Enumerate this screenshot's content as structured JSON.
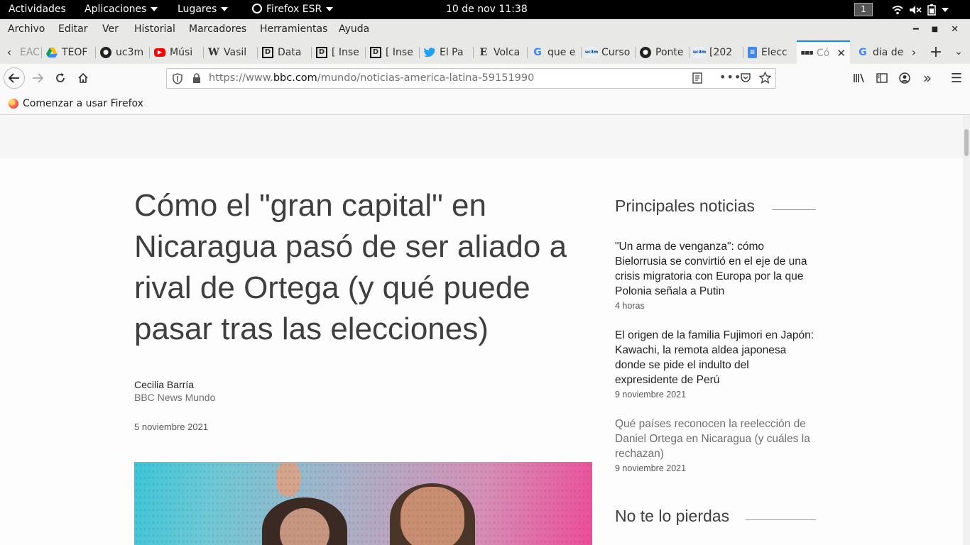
{
  "topbar": {
    "activities": "Actividades",
    "applications": "Aplicaciones",
    "places": "Lugares",
    "app_name": "Firefox ESR",
    "clock": "10 de nov  11:38",
    "workspace": "1"
  },
  "menubar": {
    "items": [
      "Archivo",
      "Editar",
      "Ver",
      "Historial",
      "Marcadores",
      "Herramientas",
      "Ayuda"
    ]
  },
  "tabs": [
    {
      "label": "ÉÁC",
      "icon": "tab-overflow"
    },
    {
      "label": "TEOF",
      "icon": "google-drive-icon"
    },
    {
      "label": "uc3m",
      "icon": "github-icon"
    },
    {
      "label": "Músi",
      "icon": "youtube-icon"
    },
    {
      "label": "Vasil",
      "icon": "wikipedia-icon"
    },
    {
      "label": "Data",
      "icon": "d-icon"
    },
    {
      "label": "[ Inse",
      "icon": "d-icon"
    },
    {
      "label": "[ Inse",
      "icon": "d-icon"
    },
    {
      "label": "El Pa",
      "icon": "twitter-icon"
    },
    {
      "label": "Volca",
      "icon": "e-icon"
    },
    {
      "label": "que e",
      "icon": "google-icon"
    },
    {
      "label": "Curso",
      "icon": "uc3m-icon"
    },
    {
      "label": "Ponte",
      "icon": "github-icon"
    },
    {
      "label": "[202",
      "icon": "uc3m-icon"
    },
    {
      "label": "Elecc",
      "icon": "docs-icon"
    },
    {
      "label": "Có",
      "icon": "bbc-icon",
      "active": true
    },
    {
      "label": "dia de",
      "icon": "google-icon"
    }
  ],
  "url": {
    "prefix": "https://www.",
    "host": "bbc.com",
    "path": "/mundo/noticias-america-latina-59151990"
  },
  "bookmarks": {
    "item": "Comenzar a usar Firefox"
  },
  "article": {
    "headline": "Cómo el \"gran capital\" en Nicaragua pasó de ser aliado a rival de Ortega (y qué puede pasar tras las elecciones)",
    "author": "Cecilia Barría",
    "organization": "BBC News Mundo",
    "date": "5 noviembre 2021"
  },
  "sidebar": {
    "title": "Principales noticias",
    "items": [
      {
        "headline": "\"Un arma de venganza\": cómo Bielorrusia se convirtió en el eje de una crisis migratoria con Europa por la que Polonia señala a Putin",
        "time": "4 horas"
      },
      {
        "headline": "El origen de la familia Fujimori en Japón: Kawachi, la remota aldea japonesa donde se pide el indulto del expresidente de Perú",
        "time": "9 noviembre 2021"
      },
      {
        "headline": "Qué países reconocen la reelección de Daniel Ortega en Nicaragua (y cuáles la rechazan)",
        "time": "9 noviembre 2021"
      }
    ],
    "title2": "No te lo pierdas"
  }
}
